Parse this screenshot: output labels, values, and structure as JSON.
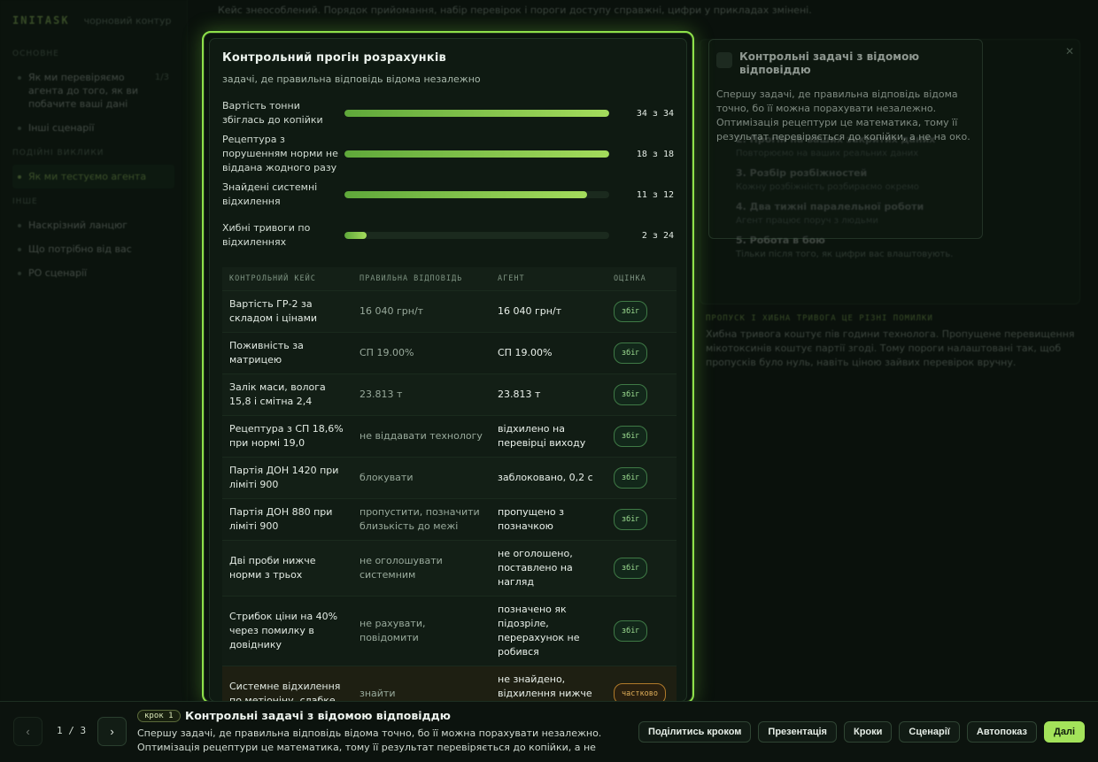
{
  "bg": {
    "brand": "INITASK",
    "brand_sub": "чорновий контур",
    "sections": [
      {
        "title": "ОСНОВНЕ",
        "items": [
          {
            "label": "Як ми перевіряємо агента до того, як ви побачите ваші дані",
            "num": "1/3",
            "active": false
          },
          {
            "label": "Інші сценарії",
            "num": "",
            "active": false
          }
        ]
      },
      {
        "title": "ПОДІЙНІ ВИКЛИКИ",
        "items": [
          {
            "label": "Як ми тестуємо агента",
            "num": "",
            "active": true
          }
        ]
      },
      {
        "title": "ІНШЕ",
        "items": [
          {
            "label": "Наскрізний ланцюг",
            "num": "",
            "active": false
          },
          {
            "label": "Що потрібно від вас",
            "num": "",
            "active": false
          },
          {
            "label": "PO сценарії",
            "num": "",
            "active": false
          }
        ]
      }
    ],
    "top_note": "Кейс знеособлений. Порядок прийомання, набір перевірок і пороги доступу справжні, цифри у прикладах змінені.",
    "steps": [
      {
        "title": "2. Прогін на ваших закритих даних",
        "sub": "Повторюємо на ваших реальних даних"
      },
      {
        "title": "3. Розбір розбіжностей",
        "sub": "Кожну розбіжність розбираємо окремо"
      },
      {
        "title": "4. Два тижні паралельної роботи",
        "sub": "Агент працює поруч з людьми"
      },
      {
        "title": "5. Робота в бою",
        "sub": "Тільки після того, як цифри вас влаштовують."
      }
    ],
    "mono_heading": "ПРОПУСК І ХИБНА ТРИВОГА ЦЕ РІЗНІ ПОМИЛКИ",
    "paragraph": "Хибна тривога коштує пів години технолога. Пропущене перевищення мікотоксинів коштує партії згоді. Тому пороги налаштовані так, щоб пропусків було нуль, навіть ціною зайвих перевірок вручну."
  },
  "side": {
    "title": "Контрольні задачі з відомою відповіддю",
    "body": "Спершу задачі, де правильна відповідь відома точно, бо її можна порахувати незалежно. Оптимізація рецептури це математика, тому її результат перевіряється до копійки, а не на око."
  },
  "modal": {
    "title": "Контрольний прогін розрахунків",
    "subtitle": "задачі, де правильна відповідь відома незалежно",
    "metrics": [
      {
        "label": "Вартість тонни збіглась до копійки",
        "value": 34,
        "total": 34,
        "count": "34 з 34"
      },
      {
        "label": "Рецептура з порушенням норми не віддана жодного разу",
        "value": 18,
        "total": 18,
        "count": "18 з 18"
      },
      {
        "label": "Знайдені системні відхилення",
        "value": 11,
        "total": 12,
        "count": "11 з 12"
      },
      {
        "label": "Хибні тривоги по відхиленнях",
        "value": 2,
        "total": 24,
        "count": "2 з 24"
      }
    ],
    "table": {
      "headers": [
        "КОНТРОЛЬНИЙ КЕЙС",
        "ПРАВИЛЬНА ВІДПОВІДЬ",
        "АГЕНТ",
        "ОЦІНКА"
      ],
      "rows": [
        {
          "case": "Вартість ГР-2 за складом і цінами",
          "answer": "16 040 грн/т",
          "agent": "16 040 грн/т",
          "grade": "збіг",
          "partial": false
        },
        {
          "case": "Поживність за матрицею",
          "answer": "СП 19.00%",
          "agent": "СП 19.00%",
          "grade": "збіг",
          "partial": false
        },
        {
          "case": "Залік маси, волога 15,8 і смітна 2,4",
          "answer": "23.813 т",
          "agent": "23.813 т",
          "grade": "збіг",
          "partial": false
        },
        {
          "case": "Рецептура з СП 18,6% при нормі 19,0",
          "answer": "не віддавати технологу",
          "agent": "відхилено на перевірці виходу",
          "grade": "збіг",
          "partial": false
        },
        {
          "case": "Партія ДОН 1420 при ліміті 900",
          "answer": "блокувати",
          "agent": "заблоковано, 0,2 с",
          "grade": "збіг",
          "partial": false
        },
        {
          "case": "Партія ДОН 880 при ліміті 900",
          "answer": "пропустити, позначити близькість до межі",
          "agent": "пропущено з позначкою",
          "grade": "збіг",
          "partial": false
        },
        {
          "case": "Дві проби нижче норми з трьох",
          "answer": "не оголошувати системним",
          "agent": "не оголошено, поставлено на нагляд",
          "grade": "збіг",
          "partial": false
        },
        {
          "case": "Стрибок ціни на 40% через помилку в довіднику",
          "answer": "не рахувати, повідомити",
          "agent": "позначено як підозріле, перерахунок не робився",
          "grade": "збіг",
          "partial": false
        },
        {
          "case": "Системне відхилення по метіоніну, слабке",
          "answer": "знайти",
          "agent": "не знайдено, відхилення нижче порогу",
          "grade": "частково",
          "partial": true
        }
      ]
    }
  },
  "bottom": {
    "prev_label": "‹",
    "next_label": "›",
    "page": "1 / 3",
    "step_badge": "крок 1",
    "step_title": "Контрольні задачі з відомою відповіддю",
    "step_desc": "Спершу задачі, де правильна відповідь відома точно, бо її можна порахувати незалежно. Оптимізація рецептури це математика, тому її результат перевіряється до копійки, а не ...",
    "actions": [
      "Поділитись кроком",
      "Презентація",
      "Кроки",
      "Сценарії",
      "Автопоказ",
      "Далі"
    ]
  },
  "colors": {
    "accent": "#a3e25a",
    "warn": "#e2b05a",
    "bg": "#0a110c"
  }
}
